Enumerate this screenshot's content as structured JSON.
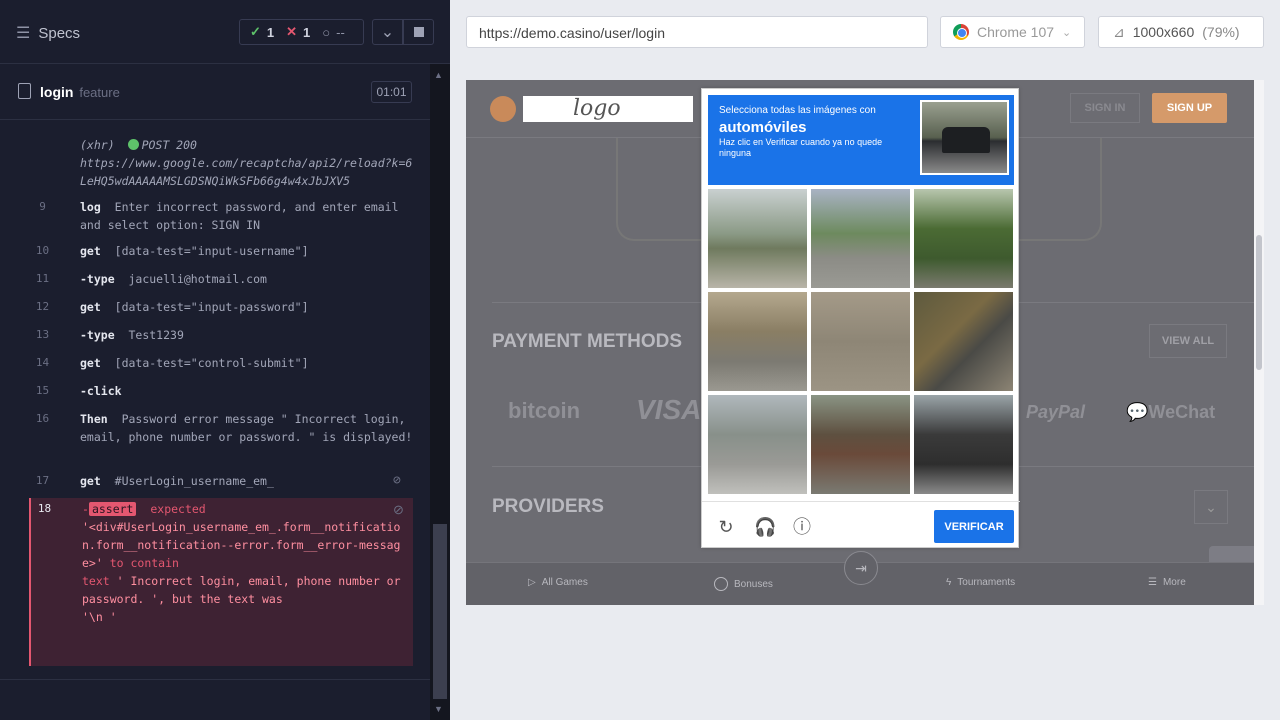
{
  "reporter": {
    "title": "Specs",
    "stats": {
      "passed": "1",
      "failed": "1",
      "pending": "--"
    },
    "file": {
      "name": "login",
      "type": "feature",
      "duration": "01:01"
    }
  },
  "commands": [
    {
      "line": "",
      "method": "(xhr)",
      "status": "POST 200",
      "text": "https://www.google.com/recaptcha/api2/reload?k=6LeHQ5wdAAAAAMSLGDSNQiWkSFb66g4w4xJbJXV5"
    },
    {
      "line": "9",
      "method": "log",
      "text": "Enter incorrect password, and enter email and select option: SIGN IN"
    },
    {
      "line": "10",
      "method": "get",
      "text": "[data-test=\"input-username\"]"
    },
    {
      "line": "11",
      "method": "-type",
      "text": "jacuelli@hotmail.com"
    },
    {
      "line": "12",
      "method": "get",
      "text": "[data-test=\"input-password\"]"
    },
    {
      "line": "13",
      "method": "-type",
      "text": "Test1239"
    },
    {
      "line": "14",
      "method": "get",
      "text": "[data-test=\"control-submit\"]"
    },
    {
      "line": "15",
      "method": "-click",
      "text": ""
    },
    {
      "line": "16",
      "method": "Then",
      "text": "Password error message \" Incorrect login, email, phone number or password. \" is displayed!"
    },
    {
      "line": "17",
      "method": "get",
      "text": "#UserLogin_username_em_"
    }
  ],
  "failed_command": {
    "line": "18",
    "dash": "-",
    "method": "assert",
    "expected": "expected",
    "selector": "'<div#UserLogin_username_em_.form__notification.form__notification--error.form__error-message>'",
    "to_contain": "to contain",
    "text_label": "text",
    "expected_text": "'                  Incorrect login, email, phone number or password.                ', but the text was",
    "actual_text": "'\\n                                  '"
  },
  "aut_header": {
    "url": "https://demo.casino/user/login",
    "browser": "Chrome 107",
    "viewport": "1000x660",
    "scale": "(79%)"
  },
  "site": {
    "logo": "logo",
    "sign_in": "SIGN IN",
    "sign_up": "SIGN UP",
    "payment_title": "PAYMENT METHODS",
    "view_all": "VIEW ALL",
    "payments": [
      "bitcoin",
      "VISA",
      "PayPal",
      "WeChat"
    ],
    "providers_title": "PROVIDERS",
    "nav": [
      "All Games",
      "Bonuses",
      "Tournaments",
      "More"
    ]
  },
  "captcha": {
    "line1": "Selecciona todas las imágenes con",
    "keyword": "automóviles",
    "line3": "Haz clic en Verificar cuando ya no quede ninguna",
    "verify": "VERIFICAR"
  },
  "colors": {
    "pass": "#5ec26a",
    "fail": "#e45770",
    "captcha_blue": "#1a73e8",
    "sign_up": "#d59a6a"
  }
}
